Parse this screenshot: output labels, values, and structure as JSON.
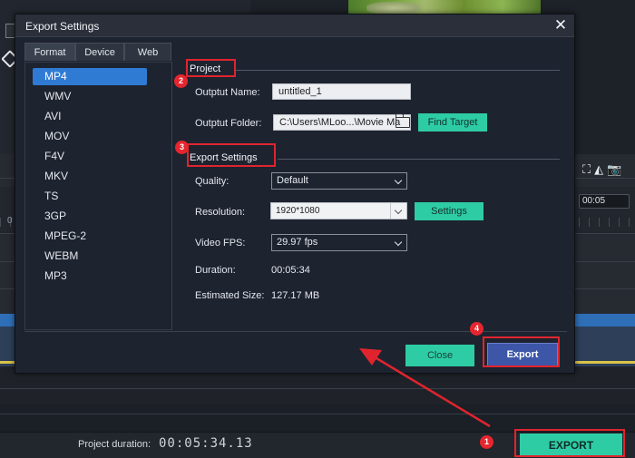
{
  "dialog": {
    "title": "Export Settings",
    "close_glyph": "✕",
    "tabs": [
      {
        "label": "Format",
        "active": true
      },
      {
        "label": "Device",
        "active": false
      },
      {
        "label": "Web",
        "active": false
      }
    ],
    "formats": [
      "MP4",
      "WMV",
      "AVI",
      "MOV",
      "F4V",
      "MKV",
      "TS",
      "3GP",
      "MPEG-2",
      "WEBM",
      "MP3"
    ],
    "selected_format": "MP4",
    "project": {
      "section_title": "Project",
      "output_name_label": "Outptut Name:",
      "output_name_value": "untitled_1",
      "output_folder_label": "Outptut Folder:",
      "output_folder_value": "C:\\Users\\MLoo...\\Movie Ma",
      "find_target_label": "Find Target"
    },
    "export_settings": {
      "section_title": "Export Settings",
      "quality_label": "Quality:",
      "quality_value": "Default",
      "resolution_label": "Resolution:",
      "resolution_value": "1920*1080",
      "settings_label": "Settings",
      "fps_label": "Video FPS:",
      "fps_value": "29.97 fps",
      "duration_label": "Duration:",
      "duration_value": "00:05:34",
      "size_label": "Estimated Size:",
      "size_value": "127.17 MB"
    },
    "buttons": {
      "close": "Close",
      "export": "Export"
    }
  },
  "app": {
    "project_duration_label": "Project duration:",
    "project_duration_value": "00:05:34.13",
    "export_button": "EXPORT",
    "timeline_zero": "0",
    "timecode_box": "00:05",
    "tool_icons": [
      "fullscreen-icon",
      "snapshot-fill-icon",
      "camera-icon"
    ]
  },
  "annotations": {
    "badges": [
      "1",
      "2",
      "3",
      "4"
    ],
    "color": "#e0242e"
  },
  "colors": {
    "accent_teal": "#2ecca5",
    "selection_blue": "#2f7bd4",
    "export_blue": "#3d56a8",
    "annotation_red": "#e0242e"
  }
}
